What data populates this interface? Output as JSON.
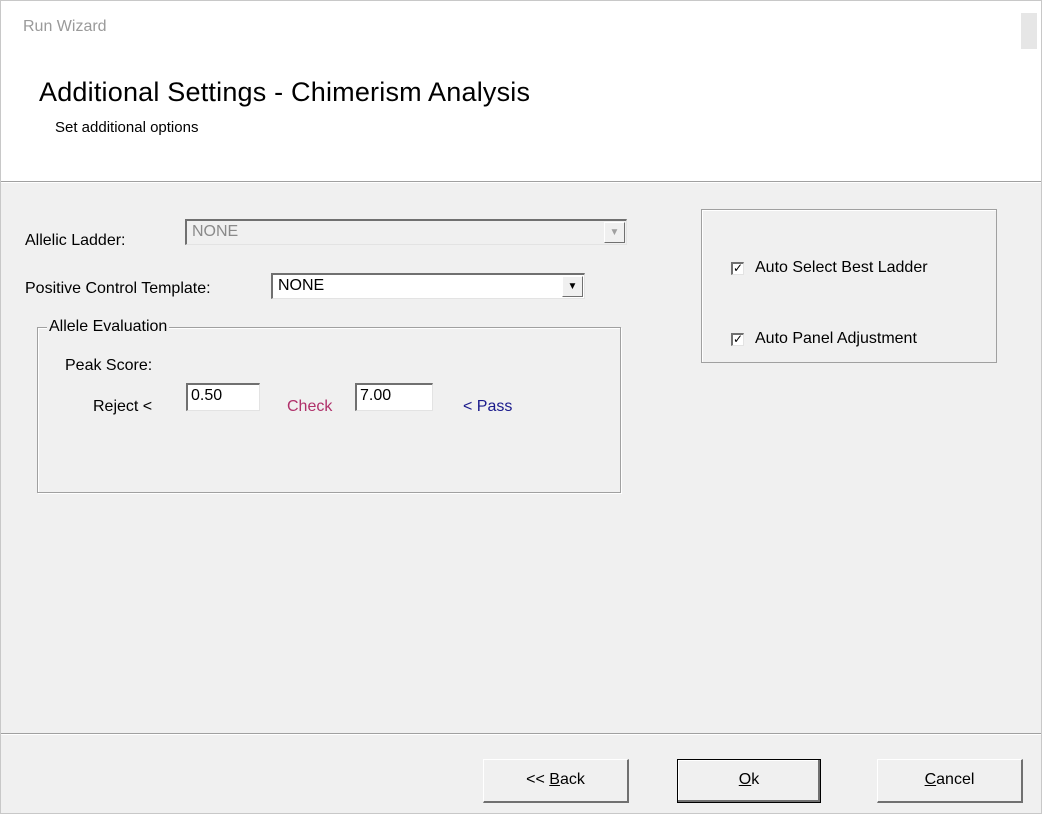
{
  "window": {
    "title": "Run Wizard"
  },
  "header": {
    "title": "Additional Settings - Chimerism Analysis",
    "subtitle": "Set additional options"
  },
  "form": {
    "allelic_ladder": {
      "label": "Allelic Ladder:",
      "value": "NONE",
      "enabled": false
    },
    "positive_control": {
      "label": "Positive Control Template:",
      "value": "NONE",
      "enabled": true
    },
    "allele_evaluation": {
      "title": "Allele Evaluation",
      "peak_score_label": "Peak Score:",
      "reject_label": "Reject <",
      "reject_value": "0.50",
      "check_label": "Check",
      "check_value": "7.00",
      "pass_label": "< Pass",
      "check_color": "#b0306a",
      "pass_color": "#1a1a8c"
    }
  },
  "options": {
    "auto_select_best_ladder": {
      "label": "Auto Select Best Ladder",
      "checked": true
    },
    "auto_panel_adjustment": {
      "label": "Auto Panel Adjustment",
      "checked": true
    }
  },
  "footer": {
    "back": {
      "prefix": "<< ",
      "mnemonic": "B",
      "rest": "ack"
    },
    "ok": {
      "prefix": "",
      "mnemonic": "O",
      "rest": "k"
    },
    "cancel": {
      "prefix": "",
      "mnemonic": "C",
      "rest": "ancel"
    }
  }
}
